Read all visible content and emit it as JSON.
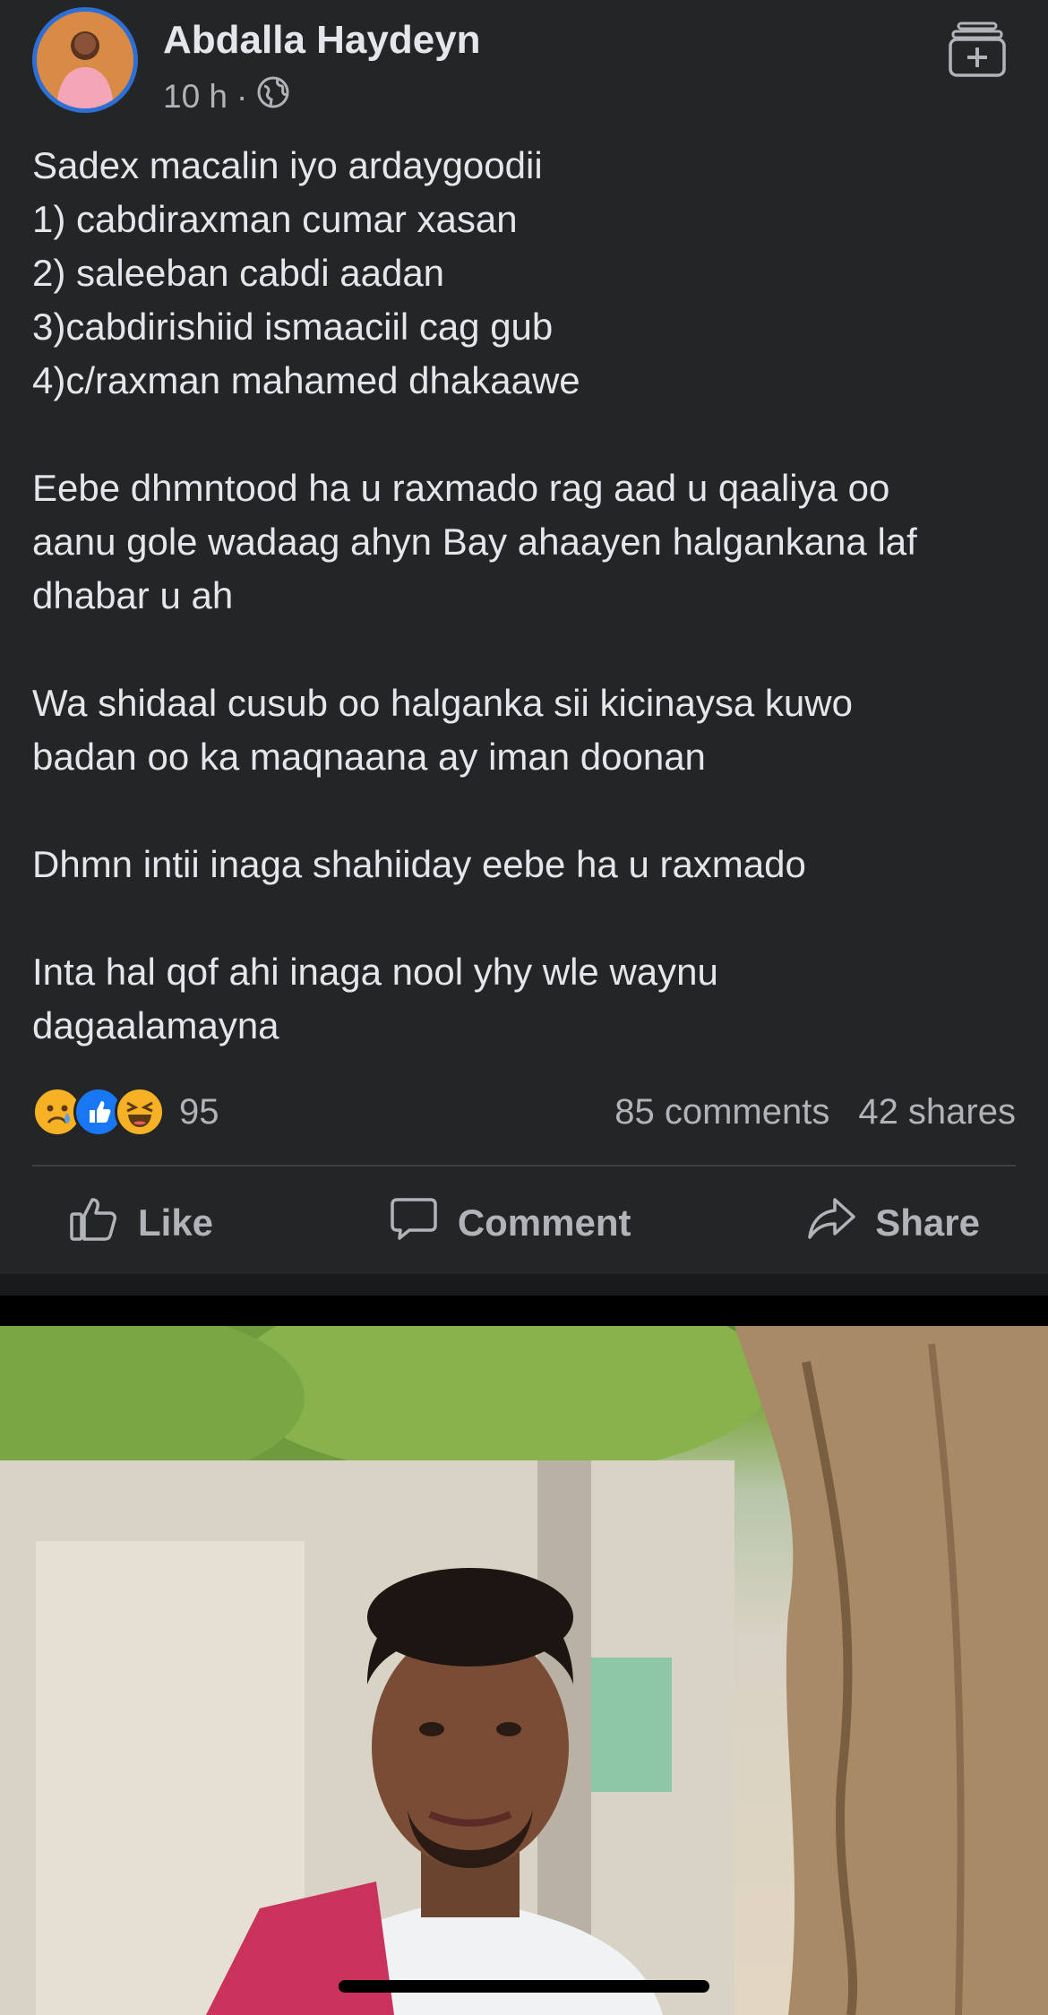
{
  "post": {
    "author": "Abdalla Haydeyn",
    "time": "10 h",
    "meta_separator": "·",
    "privacy_icon": "globe-icon",
    "paragraphs": [
      [
        "Sadex macalin iyo ardaygoodii",
        "1) cabdiraxman cumar xasan",
        "2) saleeban cabdi aadan",
        "3)cabdirishiid ismaaciil cag gub",
        "4)c/raxman mahamed dhakaawe"
      ],
      [
        "Eebe dhmntood ha u raxmado rag aad u qaaliya oo",
        "aanu gole wadaag ahyn Bay ahaayen halgankana laf",
        "dhabar u ah"
      ],
      [
        "Wa shidaal cusub oo halganka sii kicinaysa kuwo",
        "badan oo ka maqnaana ay iman doonan"
      ],
      [
        "Dhmn intii inaga shahiiday eebe ha u raxmado"
      ],
      [
        "Inta hal qof ahi inaga nool yhy wle waynu",
        "dagaalamayna"
      ]
    ]
  },
  "stats": {
    "reaction_icons": [
      "sad-reaction-icon",
      "like-reaction-icon",
      "haha-reaction-icon"
    ],
    "reaction_count": "95",
    "comments": "85 comments",
    "shares": "42 shares"
  },
  "actions": {
    "like": "Like",
    "comment": "Comment",
    "share": "Share"
  },
  "colors": {
    "background": "#242526",
    "text": "#e4e6eb",
    "secondary_text": "#b0b3b8",
    "avatar_ring": "#2d6fd4",
    "like_blue": "#1877f2",
    "emoji_yellow": "#f7b125"
  }
}
